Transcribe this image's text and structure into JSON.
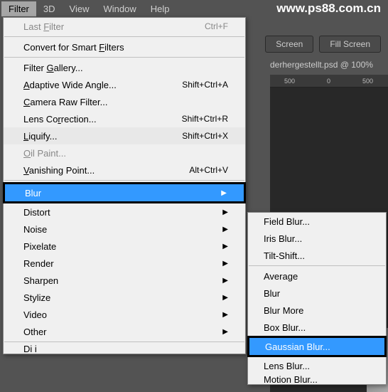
{
  "watermark": "www.ps88.com.cn",
  "menubar": {
    "filter": "Filter",
    "threeD": "3D",
    "view": "View",
    "window": "Window",
    "help": "Help"
  },
  "toolbar": {
    "screen": "Screen",
    "fill_screen": "Fill Screen"
  },
  "doc_tab": "derhergestellt.psd @ 100%",
  "ruler": {
    "t1": "500",
    "t2": "0",
    "t3": "500"
  },
  "filter_menu": {
    "last_filter": "Last Filter",
    "last_filter_sc": "Ctrl+F",
    "convert_smart": "Convert for Smart Filters",
    "filter_gallery": "Filter Gallery...",
    "adaptive_wide": "Adaptive Wide Angle...",
    "adaptive_wide_sc": "Shift+Ctrl+A",
    "camera_raw": "Camera Raw Filter...",
    "lens_corr": "Lens Correction...",
    "lens_corr_sc": "Shift+Ctrl+R",
    "liquify": "Liquify...",
    "liquify_sc": "Shift+Ctrl+X",
    "oil_paint": "Oil Paint...",
    "vanishing": "Vanishing Point...",
    "vanishing_sc": "Alt+Ctrl+V",
    "blur": "Blur",
    "distort": "Distort",
    "noise": "Noise",
    "pixelate": "Pixelate",
    "render": "Render",
    "sharpen": "Sharpen",
    "stylize": "Stylize",
    "video": "Video",
    "other": "Other"
  },
  "blur_submenu": {
    "field": "Field Blur...",
    "iris": "Iris Blur...",
    "tilt": "Tilt-Shift...",
    "average": "Average",
    "blur": "Blur",
    "blur_more": "Blur More",
    "box": "Box Blur...",
    "gaussian": "Gaussian Blur...",
    "lens": "Lens Blur...",
    "motion": "Motion Blur..."
  }
}
